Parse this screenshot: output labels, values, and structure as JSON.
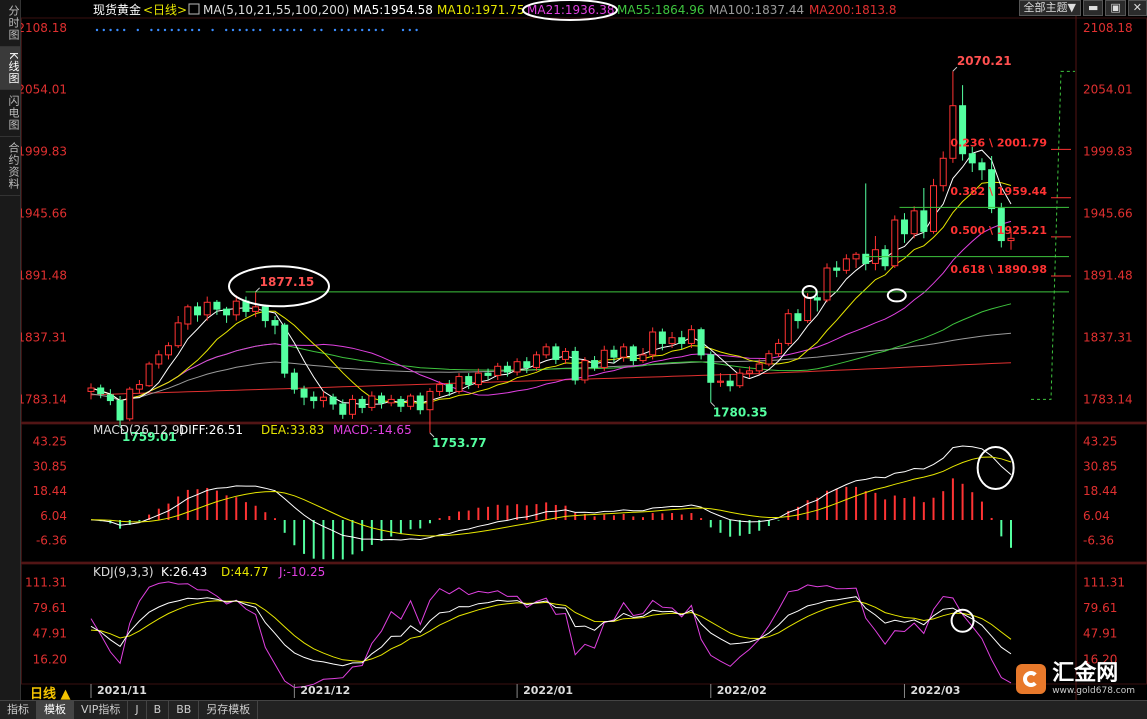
{
  "side_tabs": [
    "分时图",
    "K线图",
    "闪电图",
    "合约资料"
  ],
  "top_buttons": {
    "theme": "全部主题▼"
  },
  "bottom_tabs": [
    "指标",
    "模板",
    "VIP指标",
    "J",
    "B",
    "BB",
    "另存模板"
  ],
  "period_label": "日线 ▲",
  "logo": {
    "name": "汇金网",
    "url": "www.gold678.com"
  },
  "colors": {
    "up": "#ff3333",
    "down": "#54ffa0",
    "ma5": "#ffffff",
    "ma10": "#e6e600",
    "ma21": "#e040e0",
    "ma55": "#3ec43e",
    "ma100": "#9a9a9a",
    "ma200": "#e03030",
    "fib": "#ff3333"
  },
  "chart_data": [
    {
      "type": "candlestick",
      "header": {
        "symbol": "现货黄金",
        "period": "<日线>",
        "ma_label": "MA(5,10,21,55,100,200)",
        "items": [
          {
            "name": "MA5",
            "text": "MA5:1954.58",
            "color": "#ffffff"
          },
          {
            "name": "MA10",
            "text": "MA10:1971.75",
            "color": "#e6e600"
          },
          {
            "name": "MA21",
            "text": "MA21:1936.38",
            "color": "#e040e0"
          },
          {
            "name": "MA55",
            "text": "MA55:1864.96",
            "color": "#3ec43e"
          },
          {
            "name": "MA100",
            "text": "MA100:1837.44",
            "color": "#9a9a9a"
          },
          {
            "name": "MA200",
            "text": "MA200:1813.8",
            "color": "#e03030"
          }
        ]
      },
      "y_ticks": [
        "2108.18",
        "2054.01",
        "1999.83",
        "1945.66",
        "1891.48",
        "1837.31",
        "1783.14"
      ],
      "ylim": [
        1765,
        2115
      ],
      "x_ticks": [
        {
          "label": "2021/11",
          "index": 0
        },
        {
          "label": "2021/12",
          "index": 21
        },
        {
          "label": "2022/01",
          "index": 44
        },
        {
          "label": "2022/02",
          "index": 64
        },
        {
          "label": "2022/03",
          "index": 84
        }
      ],
      "candles": [
        [
          1790,
          1793,
          1783,
          1797
        ],
        [
          1793,
          1788,
          1784,
          1796
        ],
        [
          1787,
          1782,
          1778,
          1792
        ],
        [
          1782,
          1765,
          1759.01,
          1786
        ],
        [
          1766,
          1792,
          1764,
          1794
        ],
        [
          1792,
          1796,
          1788,
          1800
        ],
        [
          1795,
          1814,
          1794,
          1816
        ],
        [
          1814,
          1822,
          1810,
          1826
        ],
        [
          1822,
          1830,
          1818,
          1833
        ],
        [
          1830,
          1850,
          1828,
          1856
        ],
        [
          1849,
          1864,
          1844,
          1866
        ],
        [
          1864,
          1857,
          1851,
          1868
        ],
        [
          1857,
          1868,
          1852,
          1873
        ],
        [
          1868,
          1862,
          1857,
          1870
        ],
        [
          1862,
          1857,
          1850,
          1864
        ],
        [
          1857,
          1869,
          1852,
          1874
        ],
        [
          1869,
          1860,
          1855,
          1873
        ],
        [
          1860,
          1864,
          1855,
          1877.15
        ],
        [
          1864,
          1852,
          1846,
          1866
        ],
        [
          1852,
          1848,
          1840,
          1856
        ],
        [
          1848,
          1806,
          1802,
          1850
        ],
        [
          1806,
          1792,
          1788,
          1810
        ],
        [
          1792,
          1785,
          1778,
          1795
        ],
        [
          1785,
          1782,
          1775,
          1790
        ],
        [
          1782,
          1785,
          1776,
          1790
        ],
        [
          1785,
          1779,
          1774,
          1788
        ],
        [
          1779,
          1770,
          1766,
          1783
        ],
        [
          1770,
          1783,
          1766,
          1787
        ],
        [
          1783,
          1776,
          1771,
          1786
        ],
        [
          1776,
          1786,
          1773,
          1790
        ],
        [
          1786,
          1780,
          1775,
          1789
        ],
        [
          1780,
          1783,
          1777,
          1787
        ],
        [
          1783,
          1777,
          1772,
          1786
        ],
        [
          1777,
          1786,
          1774,
          1788
        ],
        [
          1786,
          1774,
          1770,
          1789
        ],
        [
          1774,
          1790,
          1753.77,
          1793
        ],
        [
          1790,
          1796,
          1786,
          1799
        ],
        [
          1796,
          1790,
          1786,
          1800
        ],
        [
          1790,
          1803,
          1788,
          1806
        ],
        [
          1803,
          1796,
          1792,
          1806
        ],
        [
          1796,
          1806,
          1793,
          1810
        ],
        [
          1806,
          1804,
          1800,
          1810
        ],
        [
          1804,
          1812,
          1800,
          1815
        ],
        [
          1812,
          1807,
          1803,
          1816
        ],
        [
          1807,
          1816,
          1804,
          1819
        ],
        [
          1816,
          1811,
          1806,
          1820
        ],
        [
          1811,
          1822,
          1808,
          1825
        ],
        [
          1822,
          1829,
          1819,
          1832
        ],
        [
          1829,
          1818,
          1814,
          1832
        ],
        [
          1818,
          1825,
          1814,
          1828
        ],
        [
          1825,
          1800,
          1796,
          1829
        ],
        [
          1800,
          1817,
          1797,
          1820
        ],
        [
          1817,
          1811,
          1808,
          1821
        ],
        [
          1811,
          1826,
          1808,
          1830
        ],
        [
          1826,
          1820,
          1815,
          1830
        ],
        [
          1820,
          1829,
          1816,
          1832
        ],
        [
          1829,
          1817,
          1813,
          1831
        ],
        [
          1817,
          1822,
          1815,
          1828
        ],
        [
          1822,
          1842,
          1818,
          1846
        ],
        [
          1842,
          1832,
          1826,
          1845
        ],
        [
          1832,
          1837,
          1828,
          1842
        ],
        [
          1837,
          1832,
          1827,
          1843
        ],
        [
          1832,
          1844,
          1828,
          1848
        ],
        [
          1844,
          1822,
          1818,
          1846
        ],
        [
          1822,
          1798,
          1780.35,
          1825
        ],
        [
          1798,
          1799,
          1794,
          1806
        ],
        [
          1799,
          1795,
          1790,
          1805
        ],
        [
          1795,
          1806,
          1793,
          1810
        ],
        [
          1806,
          1808,
          1802,
          1812
        ],
        [
          1808,
          1814,
          1805,
          1818
        ],
        [
          1814,
          1823,
          1812,
          1826
        ],
        [
          1823,
          1832,
          1820,
          1836
        ],
        [
          1832,
          1858,
          1830,
          1862
        ],
        [
          1858,
          1852,
          1845,
          1862
        ],
        [
          1852,
          1872,
          1850,
          1876
        ],
        [
          1872,
          1870,
          1860,
          1878
        ],
        [
          1870,
          1898,
          1868,
          1902
        ],
        [
          1898,
          1896,
          1890,
          1904
        ],
        [
          1896,
          1906,
          1893,
          1910
        ],
        [
          1906,
          1910,
          1898,
          1912
        ],
        [
          1910,
          1902,
          1896,
          1972
        ],
        [
          1902,
          1914,
          1896,
          1926
        ],
        [
          1914,
          1900,
          1896,
          1918
        ],
        [
          1900,
          1940,
          1898,
          1944
        ],
        [
          1940,
          1928,
          1920,
          1946
        ],
        [
          1928,
          1948,
          1924,
          1952
        ],
        [
          1948,
          1930,
          1924,
          1968
        ],
        [
          1930,
          1970,
          1928,
          1976
        ],
        [
          1970,
          1994,
          1965,
          2000
        ],
        [
          1994,
          2040,
          1990,
          2070.21
        ],
        [
          2040,
          1998,
          1992,
          2058
        ],
        [
          1998,
          1990,
          1982,
          2004
        ],
        [
          1990,
          1984,
          1975,
          1994
        ],
        [
          1984,
          1950,
          1946,
          1996
        ],
        [
          1950,
          1922,
          1916,
          1955
        ],
        [
          1922,
          1924,
          1914,
          1930
        ]
      ],
      "price_labels": [
        {
          "text": "1759.01",
          "index": 3,
          "price": 1759.01,
          "pos": "below"
        },
        {
          "text": "1877.15",
          "index": 17,
          "price": 1877.15,
          "pos": "above"
        },
        {
          "text": "1753.77",
          "index": 35,
          "price": 1753.77,
          "pos": "below"
        },
        {
          "text": "1780.35",
          "index": 64,
          "price": 1780.35,
          "pos": "below"
        },
        {
          "text": "2070.21",
          "index": 89,
          "price": 2070.21,
          "pos": "above"
        }
      ],
      "fibonacci": [
        {
          "text": "0.236 \\ 2001.79",
          "price": 2001.79
        },
        {
          "text": "0.382 \\ 1959.44",
          "price": 1959.44
        },
        {
          "text": "0.500 \\ 1925.21",
          "price": 1925.21
        },
        {
          "text": "0.618 \\ 1890.98",
          "price": 1890.98
        }
      ],
      "horizontal_lines": [
        1877.15,
        1951,
        1908
      ],
      "circles": [
        {
          "index": 19,
          "price": 1885
        }
      ]
    },
    {
      "type": "macd",
      "header": [
        {
          "text": "MACD(26,12,9)",
          "color": "#dddddd"
        },
        {
          "text": "DIFF:26.51",
          "color": "#ffffff"
        },
        {
          "text": "DEA:33.83",
          "color": "#e6e600"
        },
        {
          "text": "MACD:-14.65",
          "color": "#e040e0"
        }
      ],
      "y_ticks": [
        "43.25",
        "30.85",
        "18.44",
        "6.04",
        "-6.36"
      ],
      "ylim": [
        -16,
        47
      ]
    },
    {
      "type": "kdj",
      "header": [
        {
          "text": "KDJ(9,3,3)",
          "color": "#dddddd"
        },
        {
          "text": "K:26.43",
          "color": "#ffffff"
        },
        {
          "text": "D:44.77",
          "color": "#e6e600"
        },
        {
          "text": "J:-10.25",
          "color": "#e040e0"
        }
      ],
      "y_ticks": [
        "111.31",
        "79.61",
        "47.91",
        "16.20"
      ],
      "ylim": [
        -12,
        122
      ]
    }
  ]
}
